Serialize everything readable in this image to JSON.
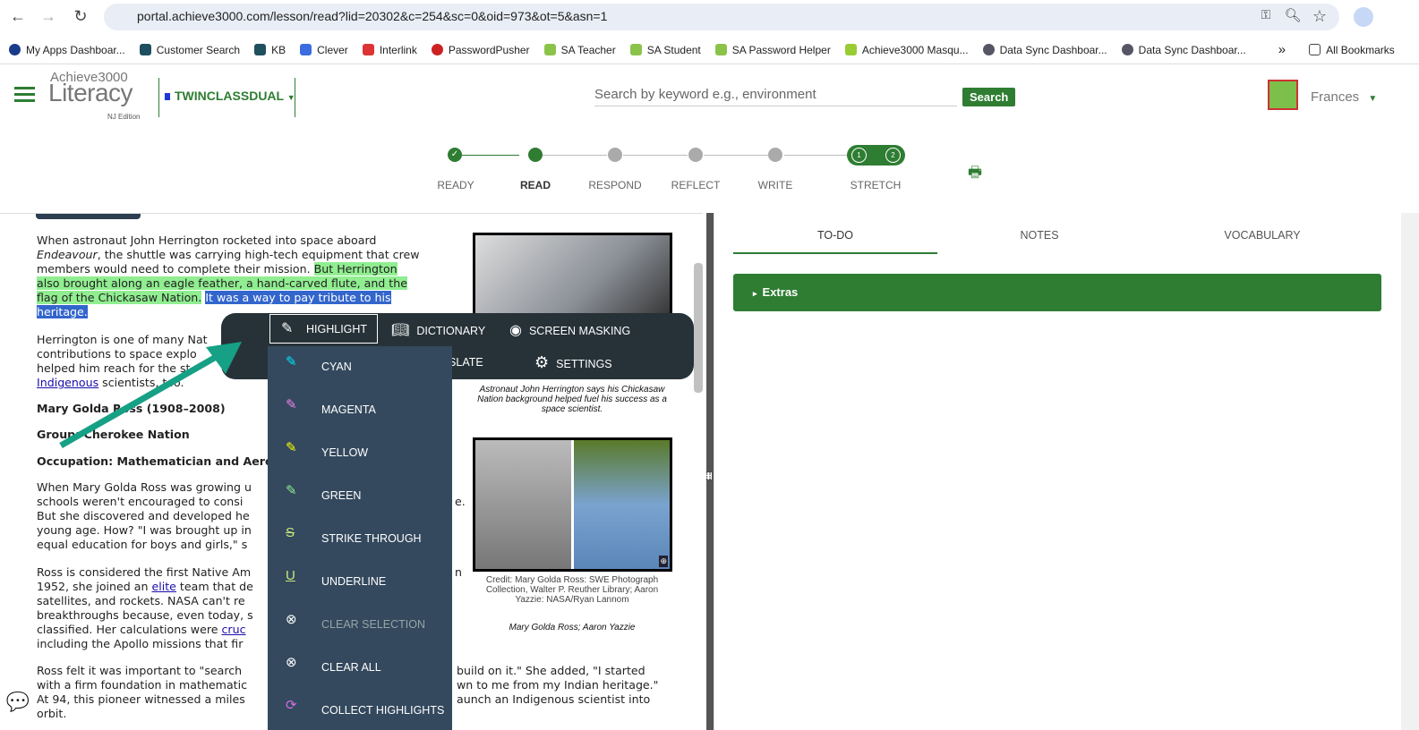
{
  "browser": {
    "url": "portal.achieve3000.com/lesson/read?lid=20302&c=254&sc=0&oid=973&ot=5&asn=1",
    "bookmarks": [
      "My Apps Dashboar...",
      "Customer Search",
      "KB",
      "Clever",
      "Interlink",
      "PasswordPusher",
      "SA Teacher",
      "SA Student",
      "SA Password Helper",
      "Achieve3000 Masqu...",
      "Data Sync Dashboar...",
      "Data Sync Dashboar..."
    ],
    "more": "»",
    "all_bookmarks": "All Bookmarks"
  },
  "header": {
    "logo_top": "Achieve3000",
    "logo_main": "Literacy",
    "logo_edition": "NJ Edition",
    "class_name": "TWINCLASSDUAL",
    "search_placeholder": "Search by keyword e.g., environment",
    "search_button": "Search",
    "user": "Frances"
  },
  "steps": [
    "READY",
    "READ",
    "RESPOND",
    "REFLECT",
    "WRITE",
    "STRETCH"
  ],
  "stretch_nums": [
    "1",
    "2"
  ],
  "article": {
    "p1": [
      "When astronaut John Herrington rocketed into space aboard",
      "Endeavour",
      ", the shuttle was carrying high-tech equipment that crew",
      "members would need to complete their mission. ",
      "But Herrington",
      "also brought along an eagle feather, a hand-carved flute, and the",
      "flag of the Chickasaw Nation.",
      "It was a way to pay tribute to his",
      "heritage."
    ],
    "p2": [
      "Herrington is one of many Nat",
      "contributions to space explo",
      "helped him reach for the st",
      "Indigenous",
      " scientists, too."
    ],
    "h1": "Mary Golda Ross (1908–2008)",
    "h2": "Group: Cherokee Nation",
    "h3": "Occupation: Mathematician and Aero",
    "p3": [
      "When Mary Golda Ross was growing u",
      "schools weren't encouraged to consi",
      "But she discovered and developed he",
      "young age. How? \"I was brought up in",
      "equal education for boys and girls,\" s",
      "e."
    ],
    "p4": [
      "Ross is considered the first Native Am",
      "1952, she joined an ",
      "elite",
      " team that de",
      "satellites, and rockets. NASA can't re",
      "breakthroughs because, even today, s",
      "classified. Her calculations were ",
      "cruc",
      "including the Apollo missions that fir",
      "n"
    ],
    "p5": [
      "Ross felt it was important to \"search",
      "with a firm foundation in mathematic",
      "At 94, this pioneer witnessed a miles",
      "orbit.",
      "build on it.\" She added, \"I started",
      "wn to me from my Indian heritage.\"",
      "aunch an Indigenous scientist into"
    ],
    "caption1": "Astronaut John Herrington says his Chickasaw Nation background helped fuel his success as a space scientist.",
    "credit2": "Credit: Mary Golda Ross: SWE Photograph Collection, Walter P. Reuther Library; Aaron Yazzie: NASA/Ryan Lannom",
    "caption2": "Mary Golda Ross; Aaron Yazzie"
  },
  "panel": {
    "tabs": [
      "TO-DO",
      "NOTES",
      "VOCABULARY"
    ],
    "active_tab": "TO-DO",
    "extras": "Extras"
  },
  "toolbar": {
    "highlight": "HIGHLIGHT",
    "dictionary": "DICTIONARY",
    "screen_masking": "SCREEN MASKING",
    "translate": "TRANSLATE",
    "settings": "SETTINGS"
  },
  "menu": [
    {
      "label": "CYAN",
      "color": "#00e5ff"
    },
    {
      "label": "MAGENTA",
      "color": "#ee82ee"
    },
    {
      "label": "YELLOW",
      "color": "#ffff00"
    },
    {
      "label": "GREEN",
      "color": "#90ee90"
    },
    {
      "label": "STRIKE THROUGH",
      "color": "#c6e87a"
    },
    {
      "label": "UNDERLINE",
      "color": "#c6e87a"
    },
    {
      "label": "CLEAR SELECTION",
      "disabled": true
    },
    {
      "label": "CLEAR ALL"
    },
    {
      "label": "COLLECT HIGHLIGHTS",
      "color": "#d070e0"
    }
  ],
  "colors": {
    "brand_green": "#2e7d32",
    "toolbar": "#263238",
    "menu": "#34495e",
    "annotation_arrow": "#16a085"
  }
}
